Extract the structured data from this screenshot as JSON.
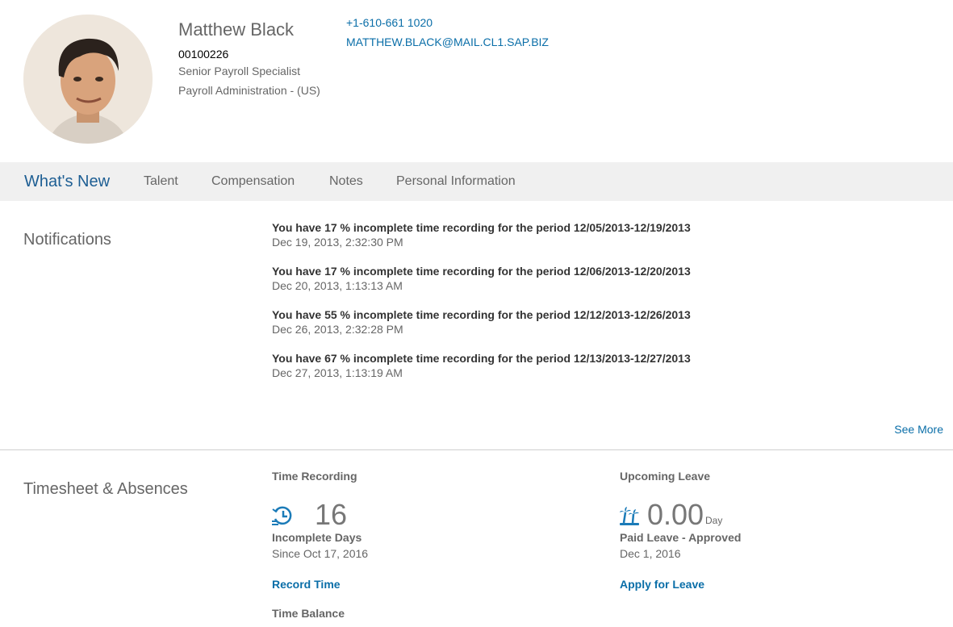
{
  "profile": {
    "name": "Matthew Black",
    "employee_id": "00100226",
    "job_title": "Senior Payroll Specialist",
    "department": "Payroll Administration - (US)",
    "phone": "+1-610-661 1020",
    "email": "MATTHEW.BLACK@MAIL.CL1.SAP.BIZ"
  },
  "tabs": [
    {
      "label": "What's New",
      "active": true
    },
    {
      "label": "Talent"
    },
    {
      "label": "Compensation"
    },
    {
      "label": "Notes"
    },
    {
      "label": "Personal Information"
    }
  ],
  "notifications": {
    "title": "Notifications",
    "items": [
      {
        "text": "You have 17 % incomplete time recording for the period 12/05/2013-12/19/2013",
        "time": "Dec 19, 2013, 2:32:30 PM"
      },
      {
        "text": "You have 17 % incomplete time recording for the period 12/06/2013-12/20/2013",
        "time": "Dec 20, 2013, 1:13:13 AM"
      },
      {
        "text": "You have 55 % incomplete time recording for the period 12/12/2013-12/26/2013",
        "time": "Dec 26, 2013, 2:32:28 PM"
      },
      {
        "text": "You have 67 % incomplete time recording for the period 12/13/2013-12/27/2013",
        "time": "Dec 27, 2013, 1:13:19 AM"
      }
    ],
    "see_more": "See More"
  },
  "timesheet": {
    "title": "Timesheet & Absences",
    "time_recording": {
      "title": "Time Recording",
      "icon": "clock-history-icon",
      "value": "16",
      "label": "Incomplete Days",
      "since": "Since Oct 17, 2016",
      "action": "Record Time"
    },
    "time_balance": {
      "title": "Time Balance"
    },
    "upcoming_leave": {
      "title": "Upcoming Leave",
      "icon": "beach-icon",
      "value": "0.00",
      "unit": "Day",
      "label": "Paid Leave - Approved",
      "date": "Dec 1, 2016",
      "action": "Apply for Leave"
    }
  },
  "colors": {
    "link": "#0a6ea8",
    "active_tab": "#1d5e93",
    "tabbar_bg": "#f0f0f0",
    "icon": "#1b7bb8"
  }
}
